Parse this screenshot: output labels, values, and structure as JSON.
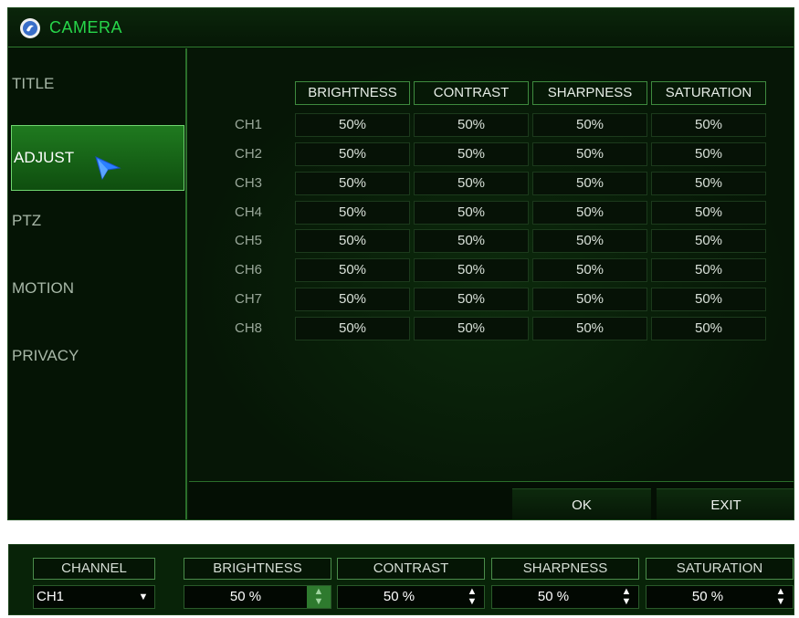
{
  "window": {
    "title": "CAMERA"
  },
  "sidebar": {
    "items": [
      {
        "label": "TITLE",
        "active": false
      },
      {
        "label": "ADJUST",
        "active": true
      },
      {
        "label": "PTZ",
        "active": false
      },
      {
        "label": "MOTION",
        "active": false
      },
      {
        "label": "PRIVACY",
        "active": false
      }
    ]
  },
  "table": {
    "columns": [
      "BRIGHTNESS",
      "CONTRAST",
      "SHARPNESS",
      "SATURATION"
    ],
    "rows": [
      {
        "channel": "CH1",
        "values": [
          "50%",
          "50%",
          "50%",
          "50%"
        ]
      },
      {
        "channel": "CH2",
        "values": [
          "50%",
          "50%",
          "50%",
          "50%"
        ]
      },
      {
        "channel": "CH3",
        "values": [
          "50%",
          "50%",
          "50%",
          "50%"
        ]
      },
      {
        "channel": "CH4",
        "values": [
          "50%",
          "50%",
          "50%",
          "50%"
        ]
      },
      {
        "channel": "CH5",
        "values": [
          "50%",
          "50%",
          "50%",
          "50%"
        ]
      },
      {
        "channel": "CH6",
        "values": [
          "50%",
          "50%",
          "50%",
          "50%"
        ]
      },
      {
        "channel": "CH7",
        "values": [
          "50%",
          "50%",
          "50%",
          "50%"
        ]
      },
      {
        "channel": "CH8",
        "values": [
          "50%",
          "50%",
          "50%",
          "50%"
        ]
      }
    ]
  },
  "footer": {
    "ok_label": "OK",
    "exit_label": "EXIT"
  },
  "detail_bar": {
    "channel": {
      "label": "CHANNEL",
      "value": "CH1"
    },
    "fields": [
      {
        "label": "BRIGHTNESS",
        "value": "50 %",
        "focused": true
      },
      {
        "label": "CONTRAST",
        "value": "50 %",
        "focused": false
      },
      {
        "label": "SHARPNESS",
        "value": "50 %",
        "focused": false
      },
      {
        "label": "SATURATION",
        "value": "50 %",
        "focused": false
      }
    ]
  },
  "icons": {
    "app": "globe-icon",
    "pointer": "mouse-cursor-icon",
    "dropdown": "chevron-down-icon",
    "spinner": "up-down-arrows-icon"
  },
  "colors": {
    "accent": "#27d64a",
    "active_item": "#1f7a1f",
    "background": "#051505",
    "cursor": "#2a7fff"
  }
}
